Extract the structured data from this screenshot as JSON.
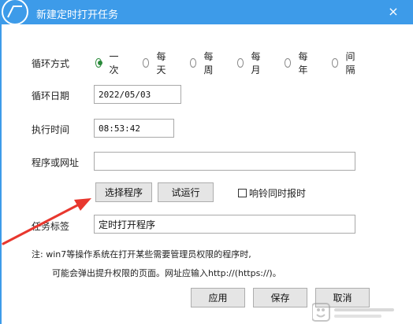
{
  "window": {
    "title": "新建定时打开任务",
    "close_glyph": "×"
  },
  "labels": {
    "cycle_mode": "循环方式",
    "cycle_date": "循环日期",
    "exec_time": "执行时间",
    "program_or_url": "程序或网址",
    "task_label": "任务标签"
  },
  "cycle_options": [
    {
      "label": "一次",
      "checked": true
    },
    {
      "label": "每天",
      "checked": false
    },
    {
      "label": "每周",
      "checked": false
    },
    {
      "label": "每月",
      "checked": false
    },
    {
      "label": "每年",
      "checked": false
    },
    {
      "label": "间隔",
      "checked": false
    }
  ],
  "fields": {
    "date_value": "2022/05/03",
    "time_value": "08:53:42",
    "program_value": "",
    "task_label_value": "定时打开程序"
  },
  "buttons": {
    "select_program": "选择程序",
    "test_run": "试运行",
    "apply": "应用",
    "save": "保存",
    "cancel": "取消"
  },
  "checkbox": {
    "label": "响铃同时报时",
    "checked": false
  },
  "notes": {
    "line1": "注: win7等操作系统在打开某些需要管理员权限的程序时,",
    "line2": "可能会弹出提升权限的页面。网址应输入http://(https://)。"
  },
  "colors": {
    "titlebar": "#3d9be9",
    "arrow": "#e8372e",
    "radio_checked": "#2a8a3a"
  }
}
